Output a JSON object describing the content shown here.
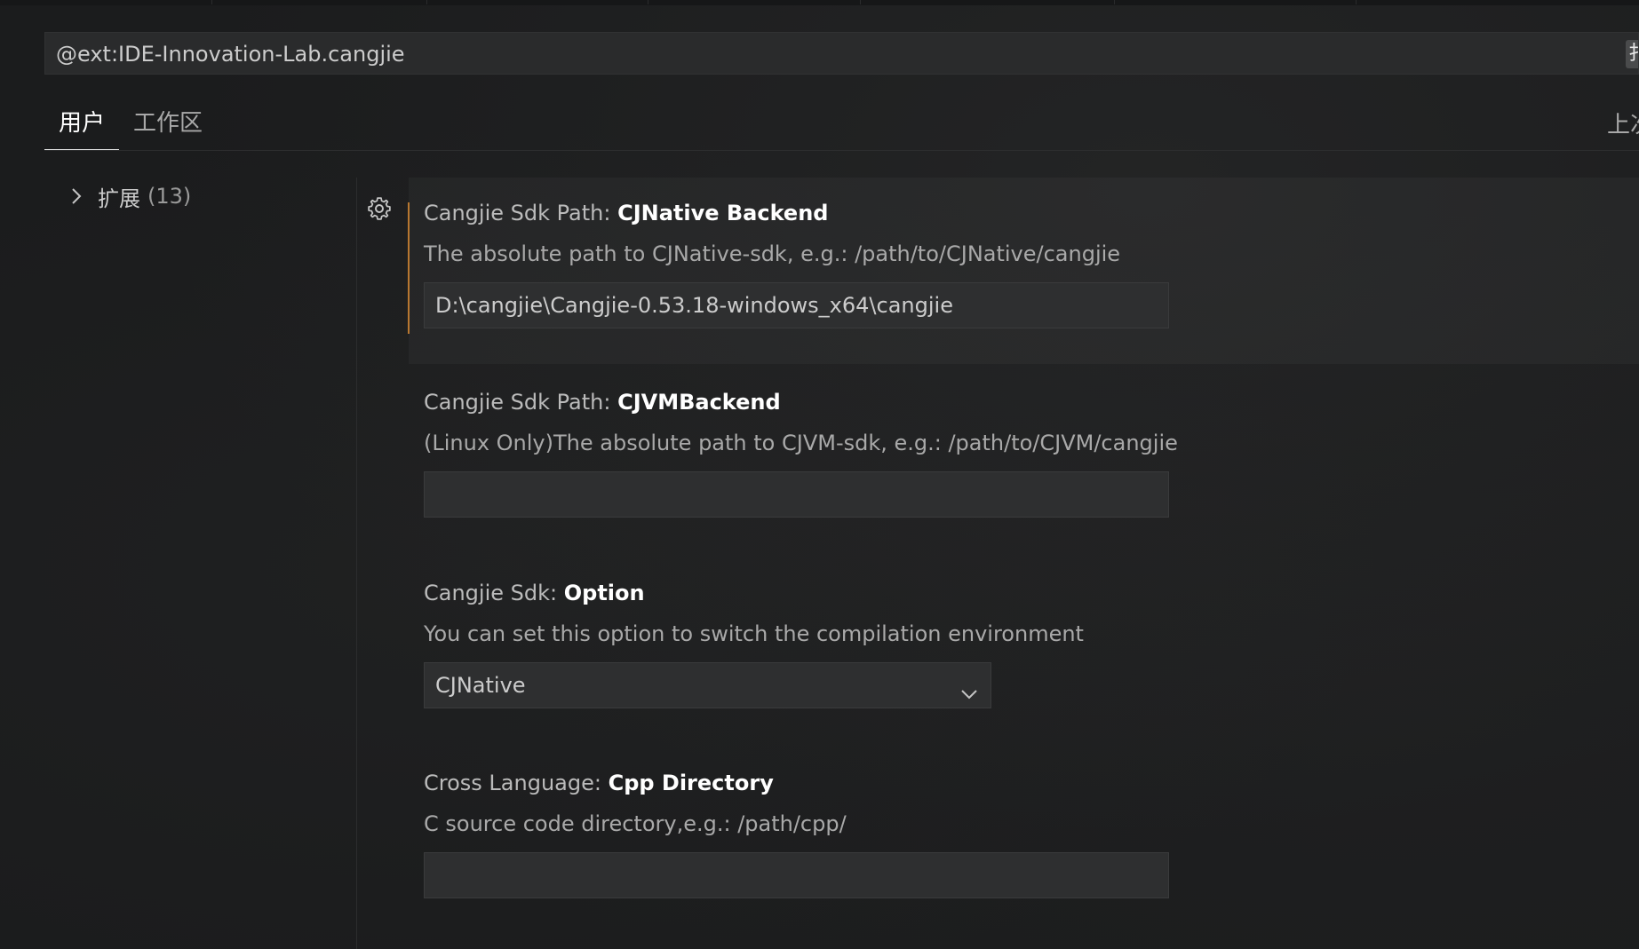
{
  "search": {
    "query": "@ext:IDE-Innovation-Lab.cangjie",
    "filter_button_glyph": "扌"
  },
  "tabs": [
    {
      "label": "用户",
      "active": true
    },
    {
      "label": "工作区",
      "active": false
    }
  ],
  "header_right": {
    "last_synced_label": "上次"
  },
  "toc": {
    "items": [
      {
        "label": "扩展",
        "count": "(13)",
        "icon": "chevron-right-icon"
      }
    ]
  },
  "settings": [
    {
      "category": "Cangjie Sdk Path: ",
      "name": "CJNative Backend",
      "description": "The absolute path to CJNative-sdk, e.g.: /path/to/CJNative/cangjie",
      "control": "text",
      "value": "D:\\cangjie\\Cangjie-0.53.18-windows_x64\\cangjie",
      "modified": true
    },
    {
      "category": "Cangjie Sdk Path: ",
      "name": "CJVMBackend",
      "description": "(Linux Only)The absolute path to CJVM-sdk, e.g.: /path/to/CJVM/cangjie",
      "control": "text",
      "value": "",
      "modified": false
    },
    {
      "category": "Cangjie Sdk: ",
      "name": "Option",
      "description": "You can set this option to switch the compilation environment",
      "control": "select",
      "value": "CJNative",
      "modified": false
    },
    {
      "category": "Cross Language: ",
      "name": "Cpp Directory",
      "description": "C source code directory,e.g.: /path/cpp/",
      "control": "text",
      "value": "",
      "modified": false
    }
  ],
  "colors": {
    "background": "#1b1c1d",
    "modified_indicator": "#b7762e",
    "input_background": "#2e2f30"
  }
}
